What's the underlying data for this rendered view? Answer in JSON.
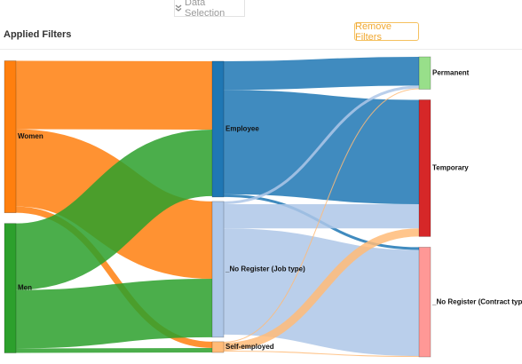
{
  "toolbar": {
    "data_selection_label": "Data Selection",
    "data_selection_icon": "double-chevron-down-icon",
    "applied_filters_label": "Applied Filters",
    "remove_filters_label": "Remove Filters",
    "accent_color": "#f5b942"
  },
  "chart_data": {
    "type": "sankey",
    "columns": [
      [
        "Women",
        "Men"
      ],
      [
        "Employee",
        "_No Register (Job type)",
        "Self-employed"
      ],
      [
        "Permanent",
        "Temporary",
        "_No Register (Contract type)"
      ]
    ],
    "nodes": [
      {
        "name": "Women",
        "color": "#ff7f0e"
      },
      {
        "name": "Men",
        "color": "#2ca02c"
      },
      {
        "name": "Employee",
        "color": "#1f77b4"
      },
      {
        "name": "_No Register (Job type)",
        "color": "#aec7e8"
      },
      {
        "name": "Self-employed",
        "color": "#ffbb78"
      },
      {
        "name": "Permanent",
        "color": "#98df8a"
      },
      {
        "name": "Temporary",
        "color": "#d62728"
      },
      {
        "name": "_No Register (Contract type)",
        "color": "#ff9896"
      }
    ],
    "links": [
      {
        "source": "Women",
        "target": "Employee",
        "value": 76
      },
      {
        "source": "Women",
        "target": "_No Register (Job type)",
        "value": 86
      },
      {
        "source": "Women",
        "target": "Self-employed",
        "value": 7
      },
      {
        "source": "Men",
        "target": "Employee",
        "value": 74
      },
      {
        "source": "Men",
        "target": "_No Register (Job type)",
        "value": 65
      },
      {
        "source": "Men",
        "target": "Self-employed",
        "value": 5
      },
      {
        "source": "Employee",
        "target": "Permanent",
        "value": 32
      },
      {
        "source": "Employee",
        "target": "Temporary",
        "value": 116
      },
      {
        "source": "Employee",
        "target": "_No Register (Contract type)",
        "value": 3
      },
      {
        "source": "_No Register (Job type)",
        "target": "Permanent",
        "value": 3
      },
      {
        "source": "_No Register (Job type)",
        "target": "Temporary",
        "value": 27
      },
      {
        "source": "_No Register (Job type)",
        "target": "_No Register (Contract type)",
        "value": 118
      },
      {
        "source": "Self-employed",
        "target": "Permanent",
        "value": 1
      },
      {
        "source": "Self-employed",
        "target": "Temporary",
        "value": 9
      },
      {
        "source": "Self-employed",
        "target": "_No Register (Contract type)",
        "value": 1
      }
    ]
  }
}
